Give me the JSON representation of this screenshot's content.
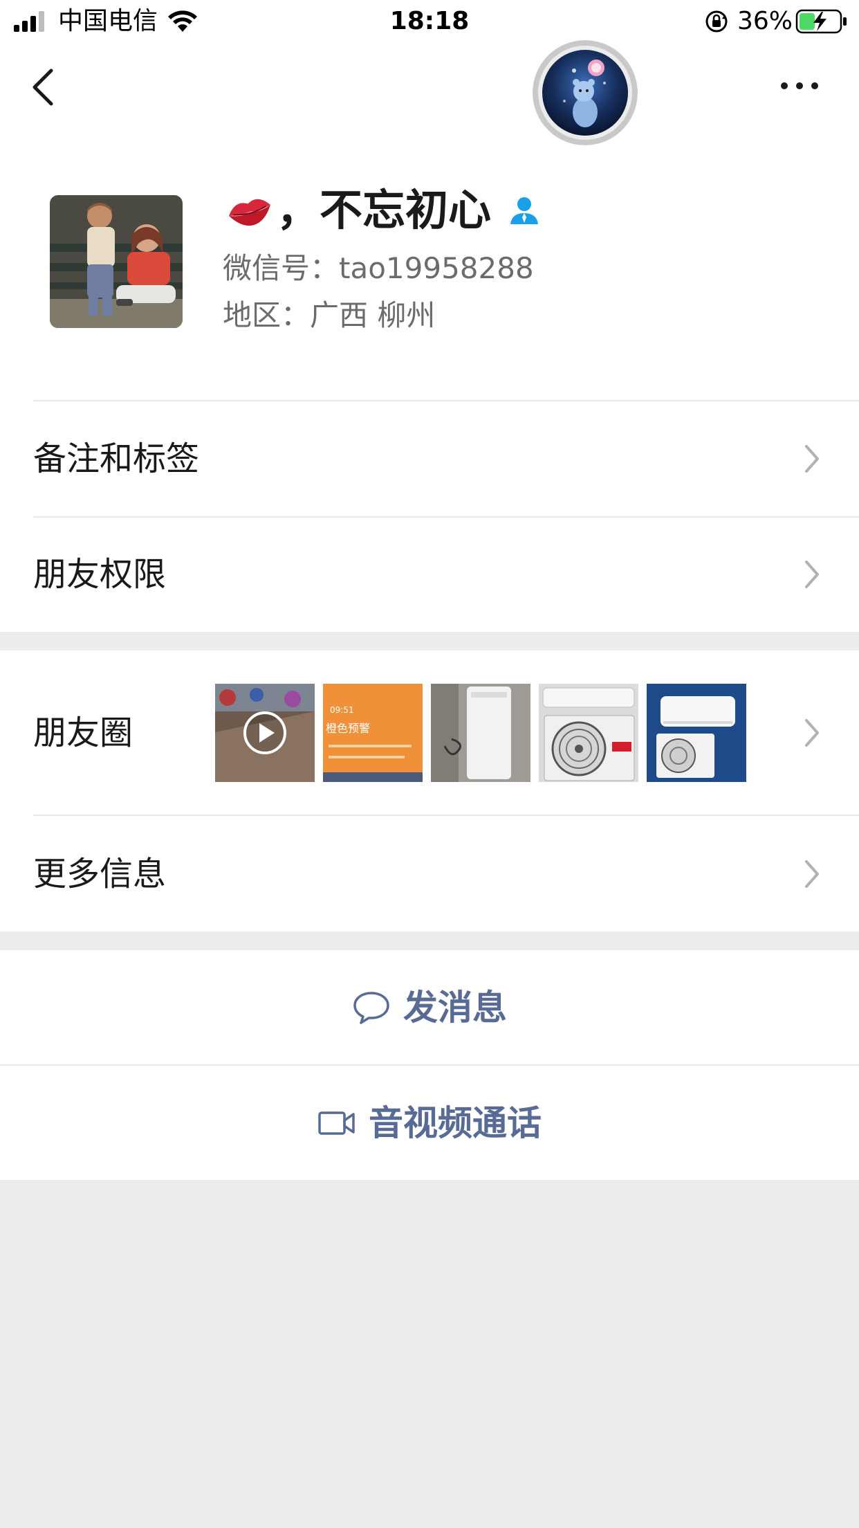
{
  "status_bar": {
    "carrier": "中国电信",
    "time": "18:18",
    "battery_percent": "36%"
  },
  "nav": {
    "back_icon": "chevron-left",
    "more_icon": "ellipsis"
  },
  "profile": {
    "name": "，不忘初心",
    "wechat_id": "微信号：tao19958288",
    "region": "地区：广西 柳州"
  },
  "rows": {
    "remarks_label": "备注和标签",
    "permissions_label": "朋友权限",
    "moments_label": "朋友圈",
    "more_info_label": "更多信息"
  },
  "moments": {
    "thumb2_time": "09:51",
    "thumb2_title": "橙色预警"
  },
  "actions": {
    "message_label": "发消息",
    "call_label": "音视频通话"
  },
  "colors": {
    "link_blue": "#576b95",
    "page_bg": "#ededed",
    "contact_icon": "#1aa0e8",
    "battery_green": "#4cd964"
  }
}
